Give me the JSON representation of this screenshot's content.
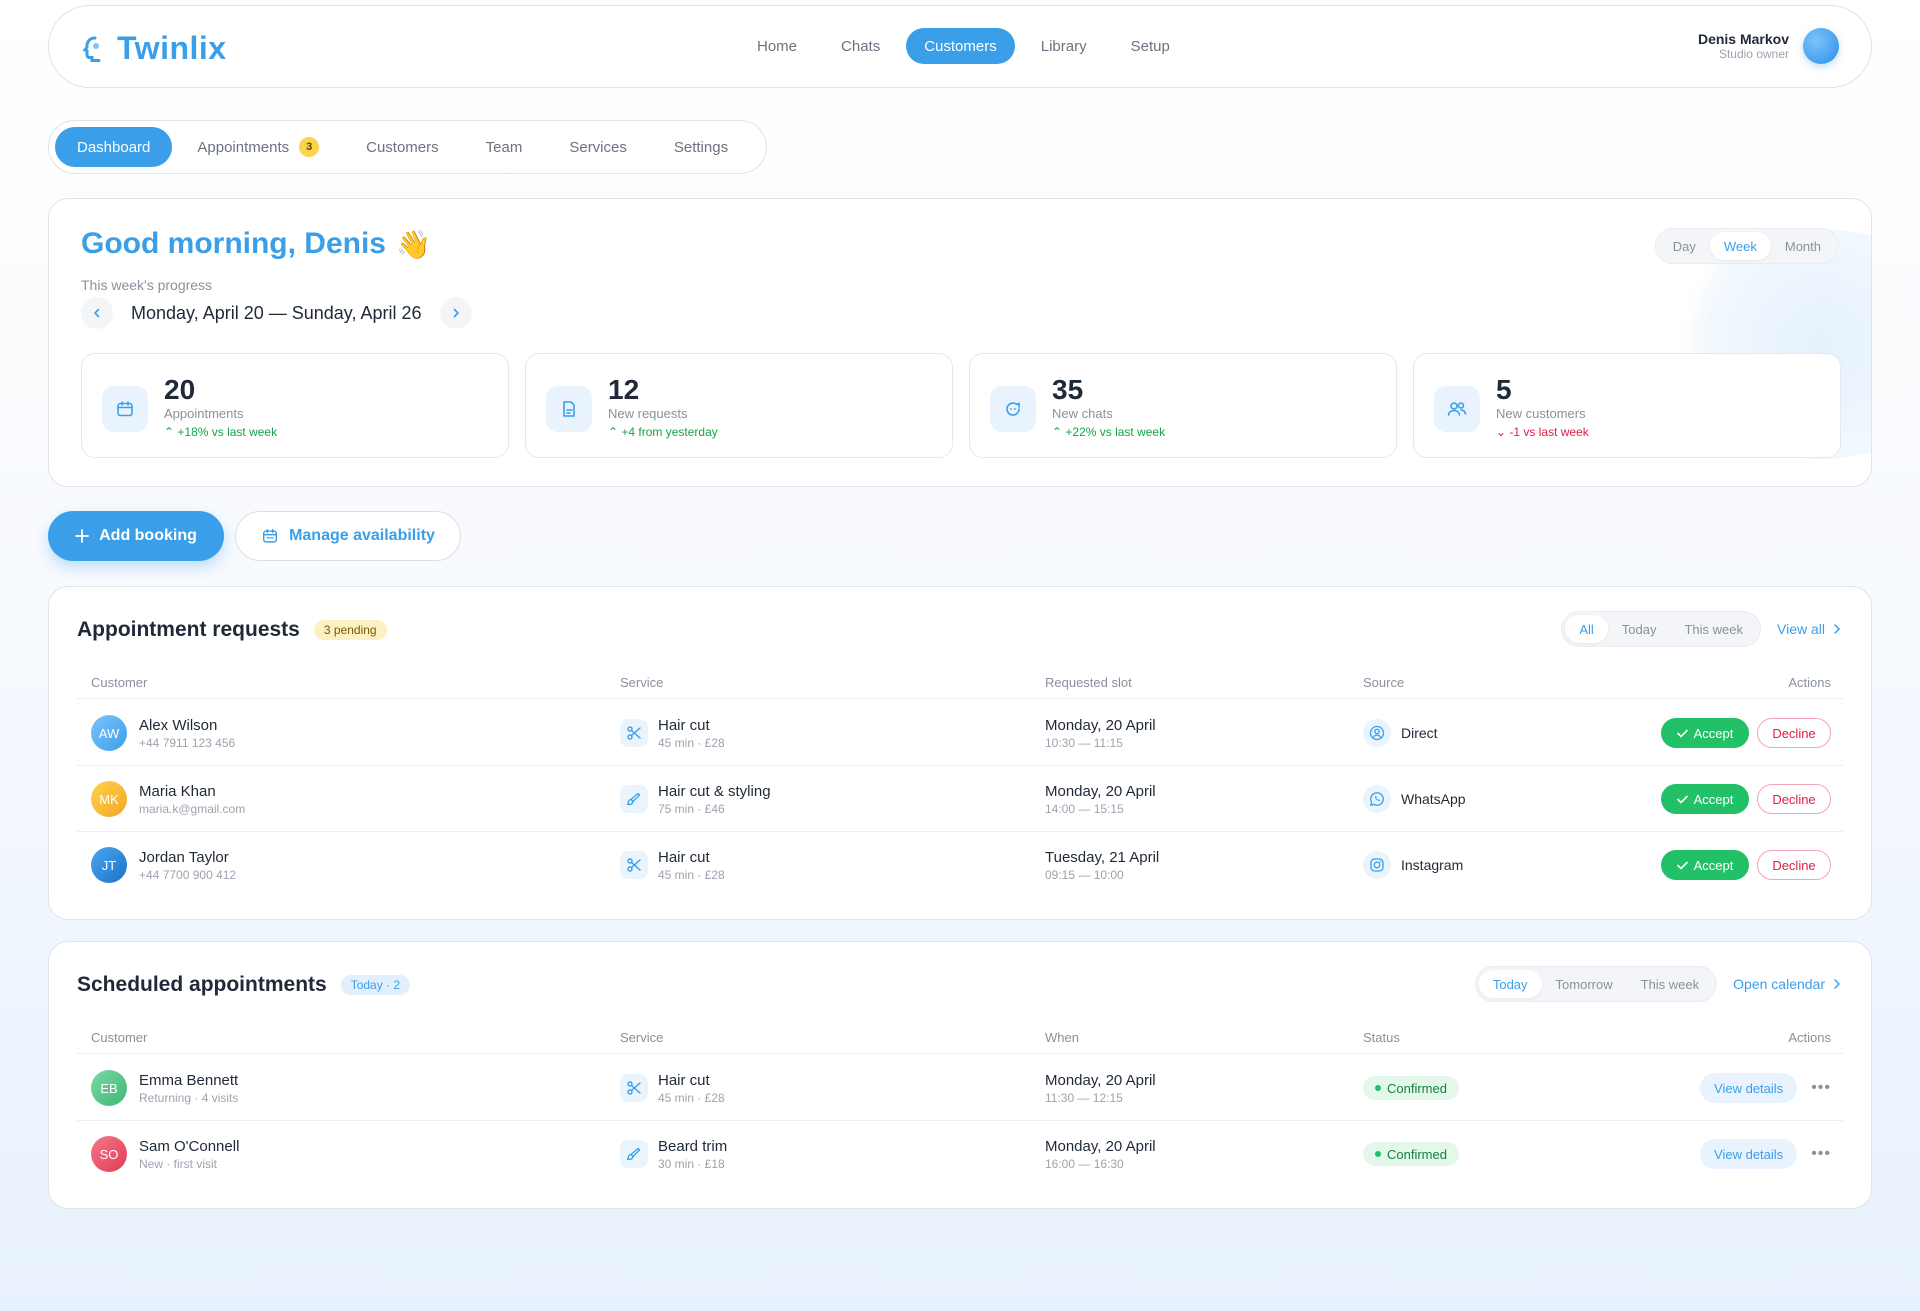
{
  "app": {
    "name": "Twinlix",
    "nav": [
      "Home",
      "Chats",
      "Customers",
      "Library",
      "Setup"
    ],
    "nav_active": "Customers",
    "user": {
      "name": "Denis Markov",
      "role": "Studio owner"
    }
  },
  "subtabs": {
    "items": [
      "Dashboard",
      "Appointments",
      "Customers",
      "Team",
      "Services",
      "Settings"
    ],
    "active": "Dashboard",
    "appointments_badge": "3"
  },
  "hero": {
    "greeting": "Good morning, Denis",
    "wave": "👋",
    "progress_label": "This week's progress",
    "week_range": "Monday, April 20 — Sunday, April 26",
    "ranges": [
      "Day",
      "Week",
      "Month"
    ],
    "range_active": "Week",
    "stats": [
      {
        "value": "20",
        "label": "Appointments",
        "delta": "+18% vs last week",
        "trend": "up",
        "icon": "calendar-icon"
      },
      {
        "value": "12",
        "label": "New requests",
        "delta": "+4 from yesterday",
        "trend": "up",
        "icon": "document-icon"
      },
      {
        "value": "35",
        "label": "New chats",
        "delta": "+22% vs last week",
        "trend": "up",
        "icon": "chat-icon"
      },
      {
        "value": "5",
        "label": "New customers",
        "delta": "-1 vs last week",
        "trend": "down",
        "icon": "users-icon"
      }
    ]
  },
  "actions": {
    "add_booking": "Add booking",
    "manage_availability": "Manage availability"
  },
  "requests": {
    "title": "Appointment requests",
    "badge": "3 pending",
    "filters": [
      "All",
      "Today",
      "This week"
    ],
    "filter_active": "All",
    "view_all": "View all",
    "columns": [
      "Customer",
      "Service",
      "Requested slot",
      "Source",
      "Actions"
    ],
    "accept_label": "Accept",
    "decline_label": "Decline",
    "rows": [
      {
        "initials": "AW",
        "name": "Alex Wilson",
        "contact": "+44 7911 123 456",
        "service": "Hair cut",
        "service_meta": "45 min · £28",
        "service_icon": "scissors-icon",
        "day": "Monday, 20 April",
        "time": "10:30 — 11:15",
        "source": "Direct",
        "source_icon": "person-icon"
      },
      {
        "initials": "MK",
        "name": "Maria Khan",
        "contact": "maria.k@gmail.com",
        "service": "Hair cut & styling",
        "service_meta": "75 min · £46",
        "service_icon": "brush-icon",
        "day": "Monday, 20 April",
        "time": "14:00 — 15:15",
        "source": "WhatsApp",
        "source_icon": "whatsapp-icon"
      },
      {
        "initials": "JT",
        "name": "Jordan Taylor",
        "contact": "+44 7700 900 412",
        "service": "Hair cut",
        "service_meta": "45 min · £28",
        "service_icon": "scissors-icon",
        "day": "Tuesday, 21 April",
        "time": "09:15 — 10:00",
        "source": "Instagram",
        "source_icon": "instagram-icon"
      }
    ]
  },
  "scheduled": {
    "title": "Scheduled appointments",
    "badge": "Today · 2",
    "filters": [
      "Today",
      "Tomorrow",
      "This week"
    ],
    "filter_active": "Today",
    "open_calendar": "Open calendar",
    "columns": [
      "Customer",
      "Service",
      "When",
      "Status",
      "Actions"
    ],
    "details_label": "View details",
    "rows": [
      {
        "initials": "EB",
        "name": "Emma Bennett",
        "meta": "Returning · 4 visits",
        "service": "Hair cut",
        "service_meta": "45 min · £28",
        "service_icon": "scissors-icon",
        "day": "Monday, 20 April",
        "time": "11:30 — 12:15",
        "status": "Confirmed"
      },
      {
        "initials": "SO",
        "name": "Sam O'Connell",
        "meta": "New · first visit",
        "service": "Beard trim",
        "service_meta": "30 min · £18",
        "service_icon": "brush-icon",
        "day": "Monday, 20 April",
        "time": "16:00 — 16:30",
        "status": "Confirmed"
      }
    ]
  },
  "colors": {
    "accent": "#3a9fe8",
    "success": "#22c067",
    "danger": "#e11d48",
    "avatars": [
      "#3a9fe8",
      "#f5b82e",
      "#2f86d8",
      "#4cc17e",
      "#e9475e"
    ]
  }
}
